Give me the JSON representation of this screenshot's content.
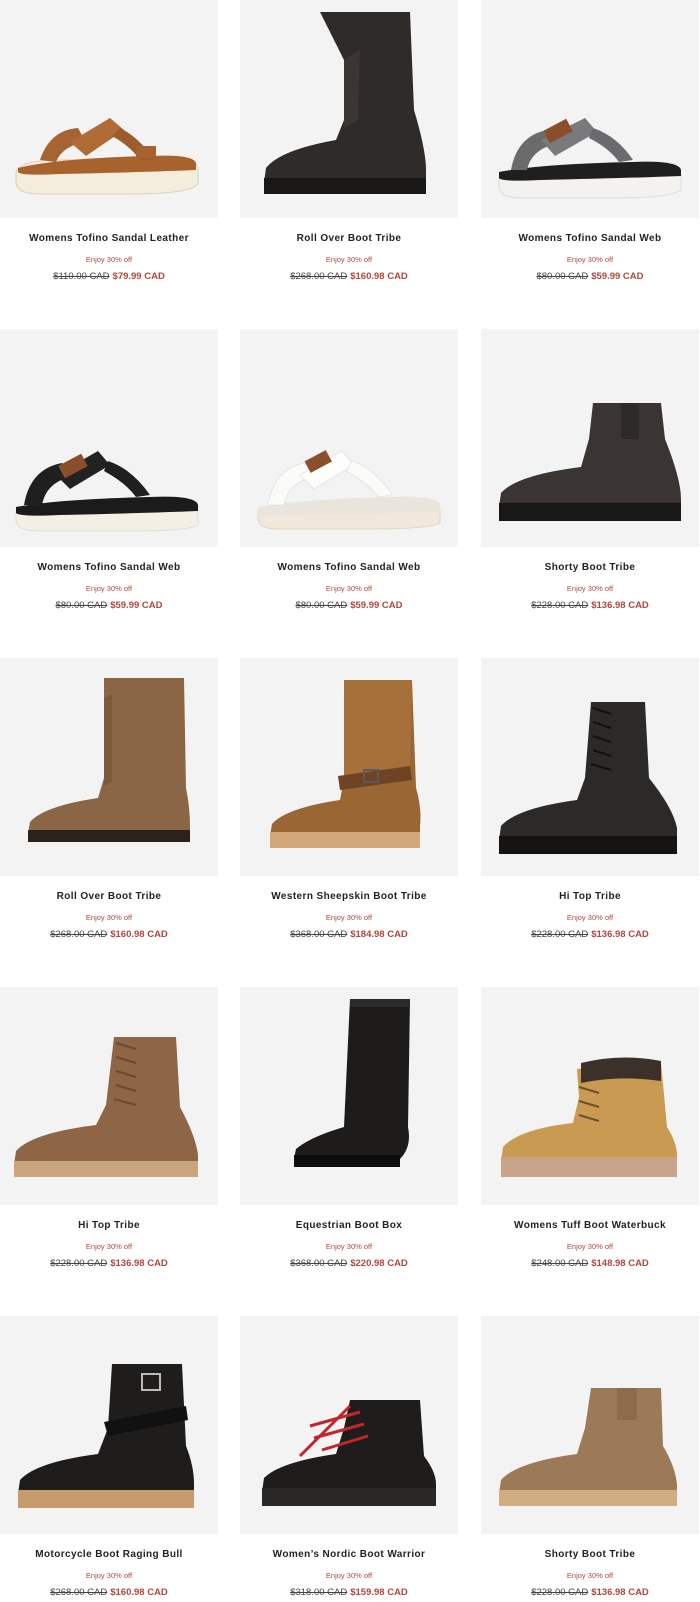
{
  "products": [
    {
      "name": "Womens Tofino Sandal Leather",
      "promo": "Enjoy 30% off",
      "old_price": "$110.00 CAD",
      "sale_price": "$79.99 CAD",
      "image": "tan-leather-sandal"
    },
    {
      "name": "Roll Over Boot Tribe",
      "promo": "Enjoy 30% off",
      "old_price": "$268.00 CAD",
      "sale_price": "$160.98 CAD",
      "image": "black-tall-boot"
    },
    {
      "name": "Womens Tofino Sandal Web",
      "promo": "Enjoy 30% off",
      "old_price": "$80.00 CAD",
      "sale_price": "$59.99 CAD",
      "image": "grey-web-sandal"
    },
    {
      "name": "Womens Tofino Sandal Web",
      "promo": "Enjoy 30% off",
      "old_price": "$80.00 CAD",
      "sale_price": "$59.99 CAD",
      "image": "black-web-sandal"
    },
    {
      "name": "Womens Tofino Sandal Web",
      "promo": "Enjoy 30% off",
      "old_price": "$80.00 CAD",
      "sale_price": "$59.99 CAD",
      "image": "white-web-sandal"
    },
    {
      "name": "Shorty Boot Tribe",
      "promo": "Enjoy 30% off",
      "old_price": "$228.00 CAD",
      "sale_price": "$136.98 CAD",
      "image": "black-shorty-boot"
    },
    {
      "name": "Roll Over Boot Tribe",
      "promo": "Enjoy 30% off",
      "old_price": "$268.00 CAD",
      "sale_price": "$160.98 CAD",
      "image": "brown-tall-boot"
    },
    {
      "name": "Western Sheepskin Boot Tribe",
      "promo": "Enjoy 30% off",
      "old_price": "$368.00 CAD",
      "sale_price": "$184.98 CAD",
      "image": "tan-sheepskin-boot"
    },
    {
      "name": "Hi Top Tribe",
      "promo": "Enjoy 30% off",
      "old_price": "$228.00 CAD",
      "sale_price": "$136.98 CAD",
      "image": "black-lace-boot"
    },
    {
      "name": "Hi Top Tribe",
      "promo": "Enjoy 30% off",
      "old_price": "$228.00 CAD",
      "sale_price": "$136.98 CAD",
      "image": "brown-lace-boot"
    },
    {
      "name": "Equestrian Boot Box",
      "promo": "Enjoy 30% off",
      "old_price": "$368.00 CAD",
      "sale_price": "$220.98 CAD",
      "image": "black-riding-boot"
    },
    {
      "name": "Womens Tuff Boot Waterbuck",
      "promo": "Enjoy 30% off",
      "old_price": "$248.00 CAD",
      "sale_price": "$148.98 CAD",
      "image": "wheat-work-boot"
    },
    {
      "name": "Motorcycle Boot Raging Bull",
      "promo": "Enjoy 30% off",
      "old_price": "$268.00 CAD",
      "sale_price": "$160.98 CAD",
      "image": "black-moto-boot"
    },
    {
      "name": "Women’s Nordic Boot Warrior",
      "promo": "Enjoy 30% off",
      "old_price": "$318.00 CAD",
      "sale_price": "$159.98 CAD",
      "image": "black-hiker-red-laces"
    },
    {
      "name": "Shorty Boot Tribe",
      "promo": "Enjoy 30% off",
      "old_price": "$228.00 CAD",
      "sale_price": "$136.98 CAD",
      "image": "brown-shorty-boot"
    }
  ],
  "colors": {
    "sale": "#b0473c",
    "image_bg": "#f3f3f3"
  }
}
